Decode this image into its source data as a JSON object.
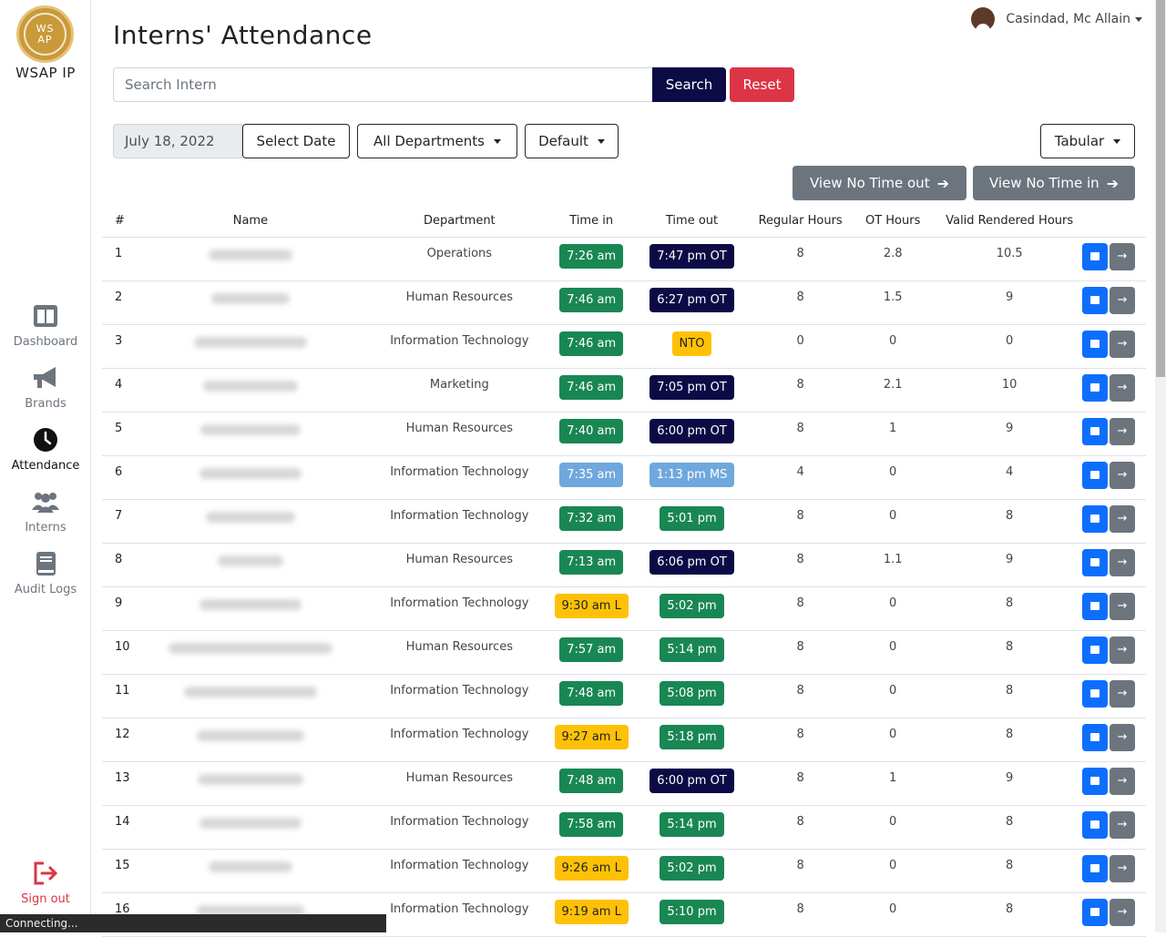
{
  "sidebar": {
    "logo_text_top": "WS",
    "logo_text_bottom": "AP",
    "brand": "WSAP IP",
    "items": [
      {
        "label": "Dashboard",
        "icon": "dashboard-icon"
      },
      {
        "label": "Brands",
        "icon": "megaphone-icon"
      },
      {
        "label": "Attendance",
        "icon": "clock-icon"
      },
      {
        "label": "Interns",
        "icon": "users-icon"
      },
      {
        "label": "Audit Logs",
        "icon": "book-icon"
      }
    ],
    "signout": "Sign out"
  },
  "user": {
    "name": "Casindad, Mc Allain"
  },
  "page_title": "Interns' Attendance",
  "search": {
    "placeholder": "Search Intern",
    "search_label": "Search",
    "reset_label": "Reset"
  },
  "filters": {
    "date": "July 18, 2022",
    "select_date": "Select Date",
    "department": "All Departments",
    "sort": "Default",
    "view": "Tabular"
  },
  "buttons": {
    "no_time_out": "View No Time out",
    "no_time_in": "View No Time in"
  },
  "table": {
    "headers": [
      "#",
      "Name",
      "Department",
      "Time in",
      "Time out",
      "Regular Hours",
      "OT Hours",
      "Valid Rendered Hours"
    ],
    "rows": [
      {
        "n": "1",
        "dept": "Operations",
        "tin": "7:26 am",
        "tin_c": "green",
        "tout": "7:47 pm OT",
        "tout_c": "navy",
        "reg": "8",
        "ot": "2.8",
        "valid": "10.5"
      },
      {
        "n": "2",
        "dept": "Human Resources",
        "tin": "7:46 am",
        "tin_c": "green",
        "tout": "6:27 pm OT",
        "tout_c": "navy",
        "reg": "8",
        "ot": "1.5",
        "valid": "9"
      },
      {
        "n": "3",
        "dept": "Information Technology",
        "tin": "7:46 am",
        "tin_c": "green",
        "tout": "NTO",
        "tout_c": "yellow",
        "reg": "0",
        "ot": "0",
        "valid": "0"
      },
      {
        "n": "4",
        "dept": "Marketing",
        "tin": "7:46 am",
        "tin_c": "green",
        "tout": "7:05 pm OT",
        "tout_c": "navy",
        "reg": "8",
        "ot": "2.1",
        "valid": "10"
      },
      {
        "n": "5",
        "dept": "Human Resources",
        "tin": "7:40 am",
        "tin_c": "green",
        "tout": "6:00 pm OT",
        "tout_c": "navy",
        "reg": "8",
        "ot": "1",
        "valid": "9"
      },
      {
        "n": "6",
        "dept": "Information Technology",
        "tin": "7:35 am",
        "tin_c": "lightblue",
        "tout": "1:13 pm MS",
        "tout_c": "lightblue",
        "reg": "4",
        "ot": "0",
        "valid": "4"
      },
      {
        "n": "7",
        "dept": "Information Technology",
        "tin": "7:32 am",
        "tin_c": "green",
        "tout": "5:01 pm",
        "tout_c": "green",
        "reg": "8",
        "ot": "0",
        "valid": "8"
      },
      {
        "n": "8",
        "dept": "Human Resources",
        "tin": "7:13 am",
        "tin_c": "green",
        "tout": "6:06 pm OT",
        "tout_c": "navy",
        "reg": "8",
        "ot": "1.1",
        "valid": "9"
      },
      {
        "n": "9",
        "dept": "Information Technology",
        "tin": "9:30 am L",
        "tin_c": "yellow",
        "tout": "5:02 pm",
        "tout_c": "green",
        "reg": "8",
        "ot": "0",
        "valid": "8"
      },
      {
        "n": "10",
        "dept": "Human Resources",
        "tin": "7:57 am",
        "tin_c": "green",
        "tout": "5:14 pm",
        "tout_c": "green",
        "reg": "8",
        "ot": "0",
        "valid": "8"
      },
      {
        "n": "11",
        "dept": "Information Technology",
        "tin": "7:48 am",
        "tin_c": "green",
        "tout": "5:08 pm",
        "tout_c": "green",
        "reg": "8",
        "ot": "0",
        "valid": "8"
      },
      {
        "n": "12",
        "dept": "Information Technology",
        "tin": "9:27 am L",
        "tin_c": "yellow",
        "tout": "5:18 pm",
        "tout_c": "green",
        "reg": "8",
        "ot": "0",
        "valid": "8"
      },
      {
        "n": "13",
        "dept": "Human Resources",
        "tin": "7:48 am",
        "tin_c": "green",
        "tout": "6:00 pm OT",
        "tout_c": "navy",
        "reg": "8",
        "ot": "1",
        "valid": "9"
      },
      {
        "n": "14",
        "dept": "Information Technology",
        "tin": "7:58 am",
        "tin_c": "green",
        "tout": "5:14 pm",
        "tout_c": "green",
        "reg": "8",
        "ot": "0",
        "valid": "8"
      },
      {
        "n": "15",
        "dept": "Information Technology",
        "tin": "9:26 am L",
        "tin_c": "yellow",
        "tout": "5:02 pm",
        "tout_c": "green",
        "reg": "8",
        "ot": "0",
        "valid": "8"
      },
      {
        "n": "16",
        "dept": "Information Technology",
        "tin": "9:19 am L",
        "tin_c": "yellow",
        "tout": "5:10 pm",
        "tout_c": "green",
        "reg": "8",
        "ot": "0",
        "valid": "8"
      }
    ]
  },
  "status_bar": "Connecting...",
  "colors": {
    "navy": "#0d0b46",
    "green": "#198754",
    "yellow": "#ffc107",
    "lightblue": "#6fa8dc",
    "red": "#dc3545"
  }
}
